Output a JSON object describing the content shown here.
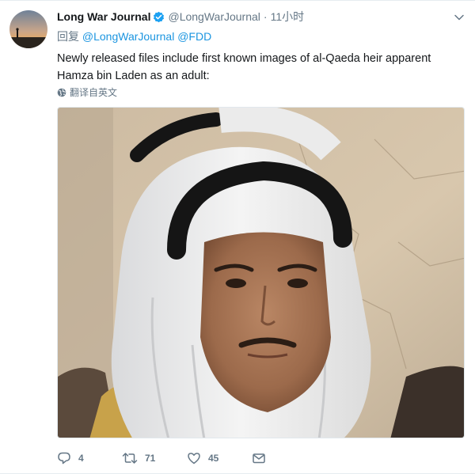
{
  "tweet": {
    "display_name": "Long War Journal",
    "handle": "@LongWarJournal",
    "separator": "·",
    "time": "11小时",
    "reply_prefix": "回复",
    "reply_to": [
      "@LongWarJournal",
      "@FDD"
    ],
    "text": "Newly released files include first known images of al-Qaeda heir apparent Hamza bin Laden as an adult:",
    "translate_label": "翻译自英文"
  },
  "actions": {
    "reply_count": "4",
    "retweet_count": "71",
    "like_count": "45"
  },
  "icons": {
    "verified": "verified-badge-icon",
    "caret": "chevron-down-icon",
    "translate": "globe-icon",
    "reply": "speech-bubble-icon",
    "retweet": "retweet-arrows-icon",
    "like": "heart-icon",
    "message": "envelope-icon"
  },
  "colors": {
    "link": "#1b95e0",
    "verified": "#1da1f2",
    "secondary_text": "#657786"
  }
}
